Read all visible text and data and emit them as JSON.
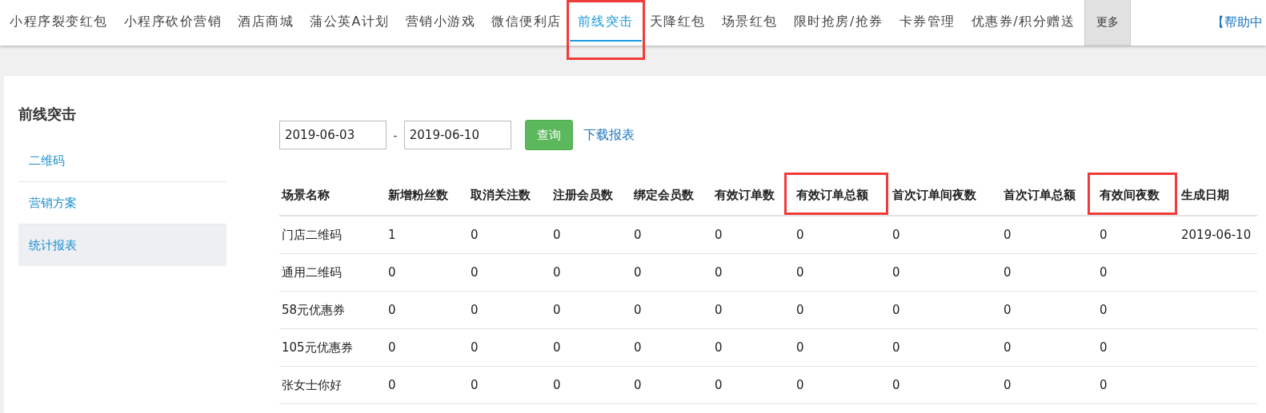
{
  "nav": {
    "tabs": [
      {
        "label": "小程序裂变红包",
        "selected": false,
        "highlighted": false
      },
      {
        "label": "小程序砍价营销",
        "selected": false,
        "highlighted": false
      },
      {
        "label": "酒店商城",
        "selected": false,
        "highlighted": false
      },
      {
        "label": "蒲公英A计划",
        "selected": false,
        "highlighted": false
      },
      {
        "label": "营销小游戏",
        "selected": false,
        "highlighted": false
      },
      {
        "label": "微信便利店",
        "selected": false,
        "highlighted": false
      },
      {
        "label": "前线突击",
        "selected": true,
        "highlighted": true
      },
      {
        "label": "天降红包",
        "selected": false,
        "highlighted": false
      },
      {
        "label": "场景红包",
        "selected": false,
        "highlighted": false
      },
      {
        "label": "限时抢房/抢券",
        "selected": false,
        "highlighted": false
      },
      {
        "label": "卡券管理",
        "selected": false,
        "highlighted": false
      },
      {
        "label": "优惠券/积分赠送",
        "selected": false,
        "highlighted": false
      }
    ],
    "more": "更多",
    "help": "【帮助中"
  },
  "sidebar": {
    "title": "前线突击",
    "items": [
      {
        "label": "二维码",
        "selected": false
      },
      {
        "label": "营销方案",
        "selected": false
      },
      {
        "label": "统计报表",
        "selected": true
      }
    ]
  },
  "filter": {
    "start": "2019-06-03",
    "separator": "-",
    "end": "2019-06-10",
    "query": "查询",
    "download": "下载报表"
  },
  "table": {
    "columns": [
      {
        "label": "场景名称",
        "highlighted": false
      },
      {
        "label": "新增粉丝数",
        "highlighted": false
      },
      {
        "label": "取消关注数",
        "highlighted": false
      },
      {
        "label": "注册会员数",
        "highlighted": false
      },
      {
        "label": "绑定会员数",
        "highlighted": false
      },
      {
        "label": "有效订单数",
        "highlighted": false
      },
      {
        "label": "有效订单总额",
        "highlighted": true
      },
      {
        "label": "首次订单间夜数",
        "highlighted": false
      },
      {
        "label": "首次订单总额",
        "highlighted": false
      },
      {
        "label": "有效间夜数",
        "highlighted": true
      },
      {
        "label": "生成日期",
        "highlighted": false
      }
    ],
    "rows": [
      [
        "门店二维码",
        "1",
        "0",
        "0",
        "0",
        "0",
        "0",
        "0",
        "0",
        "0",
        "2019-06-10"
      ],
      [
        "通用二维码",
        "0",
        "0",
        "0",
        "0",
        "0",
        "0",
        "0",
        "0",
        "0"
      ],
      [
        "58元优惠券",
        "0",
        "0",
        "0",
        "0",
        "0",
        "0",
        "0",
        "0",
        "0"
      ],
      [
        "105元优惠券",
        "0",
        "0",
        "0",
        "0",
        "0",
        "0",
        "0",
        "0",
        "0"
      ],
      [
        "张女士你好",
        "0",
        "0",
        "0",
        "0",
        "0",
        "0",
        "0",
        "0",
        "0"
      ]
    ]
  }
}
